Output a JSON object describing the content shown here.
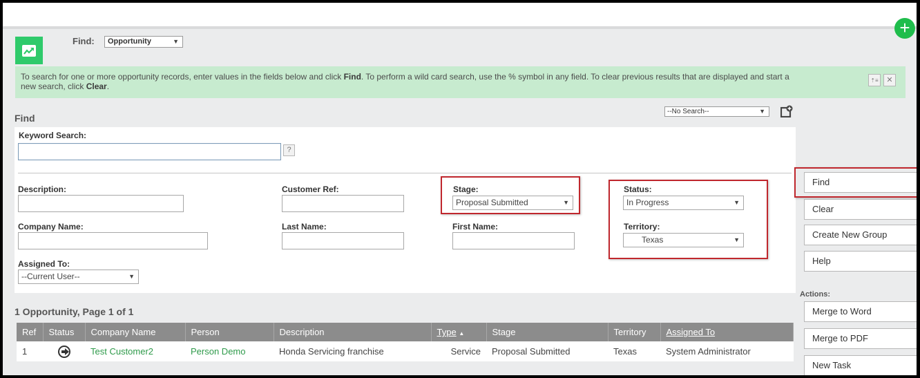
{
  "header": {
    "find_label": "Find:",
    "entity_select": "Opportunity",
    "add_icon": "plus-icon",
    "entity_icon": "trending-chart-icon"
  },
  "info": {
    "text_part1": "To search for one or more opportunity records, enter values in the fields below and click ",
    "find_bold": "Find",
    "text_part2": ". To perform a wild card search, use the % symbol in any field. To clear previous results that are displayed and start a new search, click ",
    "clear_bold": "Clear",
    "text_part3": ".",
    "expand_icon": "⇡≡",
    "close_icon": "✕"
  },
  "find_section": {
    "title": "Find",
    "saved_search": "--No Search--",
    "keyword_label": "Keyword Search:",
    "keyword_value": "",
    "help_label": "?",
    "description_label": "Description:",
    "customer_ref_label": "Customer Ref:",
    "stage_label": "Stage:",
    "stage_value": "Proposal Submitted",
    "status_label": "Status:",
    "status_value": "In Progress",
    "company_name_label": "Company Name:",
    "last_name_label": "Last Name:",
    "first_name_label": "First Name:",
    "territory_label": "Territory:",
    "territory_value": "Texas",
    "assigned_to_label": "Assigned To:",
    "assigned_to_value": "--Current User--"
  },
  "side_buttons": {
    "find": "Find",
    "clear": "Clear",
    "create_group": "Create New Group",
    "help": "Help",
    "actions_label": "Actions:",
    "merge_word": "Merge to Word",
    "merge_pdf": "Merge to PDF",
    "new_task": "New Task"
  },
  "results": {
    "title": "1 Opportunity, Page 1 of 1",
    "columns": [
      "Ref",
      "Status",
      "Company Name",
      "Person",
      "Description",
      "Type",
      "Stage",
      "Territory",
      "Assigned To"
    ],
    "sort_indicator": "▲",
    "rows": [
      {
        "ref": "1",
        "status_icon": "arrow-right-circle-icon",
        "company": "Test Customer2",
        "person": "Person Demo",
        "description": "Honda Servicing franchise",
        "type": "Service",
        "stage": "Proposal Submitted",
        "territory": "Texas",
        "assigned_to": "System Administrator"
      }
    ]
  },
  "colors": {
    "accent_green": "#2fca6b",
    "add_button": "#1fbd4c",
    "info_bg": "#c7ebcf",
    "highlight_red": "#c0272d",
    "link_green": "#2e9a4a",
    "table_header": "#8c8c8c"
  }
}
